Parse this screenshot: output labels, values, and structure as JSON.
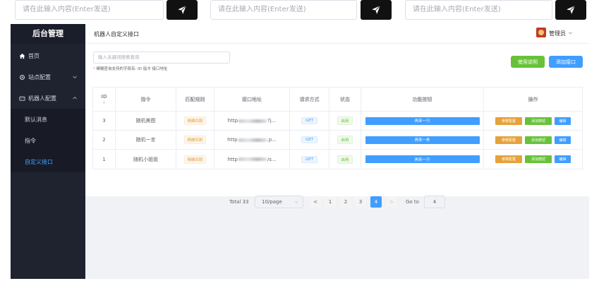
{
  "topbar": {
    "inputs": [
      {
        "placeholder": "请在此输入内容(Enter发送)"
      },
      {
        "placeholder": "请在此输入内容(Enter发送)"
      },
      {
        "placeholder": "请在此输入内容(Enter发送)"
      }
    ],
    "send_icon": "paper-plane-icon"
  },
  "sidebar": {
    "brand": "后台管理",
    "items": [
      {
        "label": "首页",
        "icon": "home-icon"
      },
      {
        "label": "站点配置",
        "icon": "gear-icon"
      },
      {
        "label": "机器人配置",
        "icon": "robot-icon"
      }
    ],
    "subitems": [
      {
        "label": "默认消息"
      },
      {
        "label": "指令"
      },
      {
        "label": "自定义接口"
      }
    ]
  },
  "header": {
    "breadcrumb": "机器人自定义接口",
    "user_name": "管理员"
  },
  "content": {
    "search_placeholder": "输入关键词搜索查询",
    "hint_star": "*",
    "hint": "模糊查询支持的字段有: ID 指令 接口地址",
    "help_button": "使用说明",
    "add_button": "添加接口"
  },
  "table": {
    "columns": [
      "ID",
      "指令",
      "匹配规则",
      "接口地址",
      "请求方式",
      "状态",
      "功能按钮",
      "操作"
    ],
    "sort_glyph": "⇕",
    "rows": [
      {
        "id": "3",
        "command": "随机美图",
        "match": "精确匹配",
        "url_start": "http",
        "url_end": "?j...",
        "method": "GET",
        "status": "启用",
        "func": "再来一只",
        "ops": [
          "参数配置",
          "添加按钮",
          "编辑"
        ]
      },
      {
        "id": "2",
        "command": "随机一言",
        "match": "精确匹配",
        "url_start": "http",
        "url_end": ".p...",
        "method": "GET",
        "status": "启用",
        "func": "再来一条",
        "ops": [
          "参数配置",
          "添加按钮",
          "编辑"
        ]
      },
      {
        "id": "1",
        "command": "随机小姐姐",
        "match": "精确匹配",
        "url_start": "http",
        "url_end": "/s...",
        "method": "GET",
        "status": "启用",
        "func": "再来一只",
        "ops": [
          "参数配置",
          "添加按钮",
          "编辑"
        ]
      }
    ]
  },
  "pager": {
    "total": "Total 33",
    "page_size": "10/page",
    "pages": [
      "1",
      "2",
      "3",
      "4"
    ],
    "current": "4",
    "prev": "<",
    "next": ">",
    "goto_label": "Go to",
    "goto_value": "4"
  },
  "colors": {
    "primary": "#409eff",
    "success": "#67c23a",
    "warning": "#e6a23c",
    "sidebar_bg": "#1f2330"
  }
}
